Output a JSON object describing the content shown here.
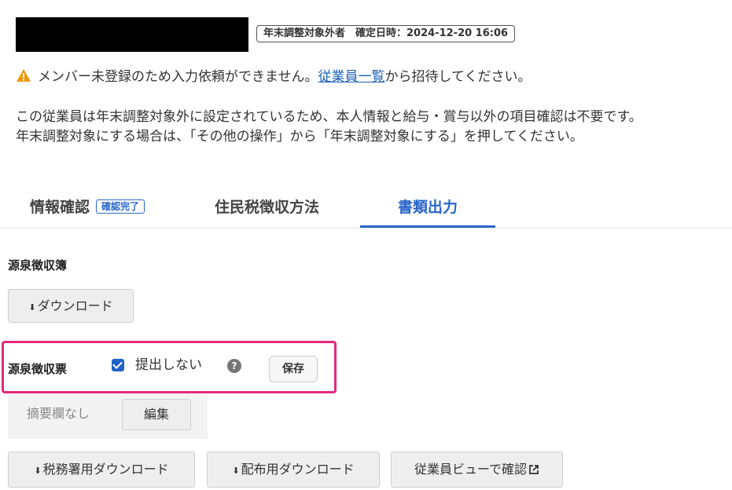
{
  "header": {
    "status_tag": "年末調整対象外者　確定日時：2024-12-20 16:06"
  },
  "warning": {
    "prefix": "メンバー未登録のため入力依頼ができません。",
    "link": "従業員一覧",
    "suffix": "から招待してください。",
    "icon": "warning-triangle-icon",
    "icon_color": "#e89a0c"
  },
  "info": {
    "line1": "この従業員は年末調整対象外に設定されているため、本人情報と給与・賞与以外の項目確認は不要です。",
    "line2": "年末調整対象にする場合は、「その他の操作」から「年末調整対象にする」を押してください。"
  },
  "tabs": [
    {
      "label": "情報確認",
      "badge": "確認完了"
    },
    {
      "label": "住民税徴収方法"
    },
    {
      "label": "書類出力",
      "active": true
    }
  ],
  "accent_color": "#2a66c9",
  "withholding_book": {
    "title": "源泉徴収簿",
    "download_label": "ダウンロード"
  },
  "withholding_slip": {
    "title": "源泉徴収票",
    "checkbox_label": "提出しない",
    "checked": true,
    "help": "?",
    "save_label": "保存",
    "summary_text": "摘要欄なし",
    "edit_label": "編集",
    "tax_office_download": "税務署用ダウンロード",
    "distribution_download": "配布用ダウンロード",
    "employee_view": "従業員ビューで確認",
    "highlight_color": "#e3297c"
  }
}
